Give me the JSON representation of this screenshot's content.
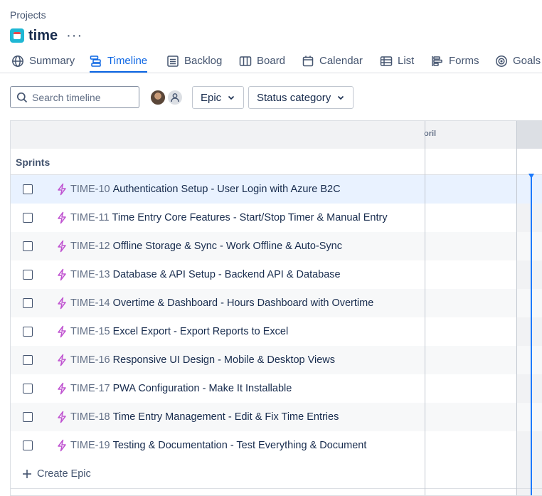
{
  "breadcrumb": "Projects",
  "project": {
    "title": "time",
    "more_icon": "more-horizontal-icon"
  },
  "tabs": [
    {
      "label": "Summary",
      "icon": "globe-icon",
      "active": false
    },
    {
      "label": "Timeline",
      "icon": "timeline-icon",
      "active": true
    },
    {
      "label": "Backlog",
      "icon": "backlog-icon",
      "active": false
    },
    {
      "label": "Board",
      "icon": "board-icon",
      "active": false
    },
    {
      "label": "Calendar",
      "icon": "calendar-icon",
      "active": false
    },
    {
      "label": "List",
      "icon": "list-icon",
      "active": false
    },
    {
      "label": "Forms",
      "icon": "forms-icon",
      "active": false
    },
    {
      "label": "Goals",
      "icon": "goals-icon",
      "active": false
    }
  ],
  "toolbar": {
    "search_placeholder": "Search timeline",
    "epic_filter": "Epic",
    "status_filter": "Status category"
  },
  "timeline": {
    "month_label": "oril",
    "sprints_label": "Sprints",
    "create_label": "Create Epic"
  },
  "epics": [
    {
      "key": "TIME-10",
      "title": "Authentication Setup - User Login with Azure B2C"
    },
    {
      "key": "TIME-11",
      "title": "Time Entry Core Features - Start/Stop Timer & Manual Entry"
    },
    {
      "key": "TIME-12",
      "title": "Offline Storage & Sync - Work Offline & Auto-Sync"
    },
    {
      "key": "TIME-13",
      "title": "Database & API Setup - Backend API & Database"
    },
    {
      "key": "TIME-14",
      "title": "Overtime & Dashboard - Hours Dashboard with Overtime"
    },
    {
      "key": "TIME-15",
      "title": "Excel Export - Export Reports to Excel"
    },
    {
      "key": "TIME-16",
      "title": "Responsive UI Design - Mobile & Desktop Views"
    },
    {
      "key": "TIME-17",
      "title": "PWA Configuration - Make It Installable"
    },
    {
      "key": "TIME-18",
      "title": "Time Entry Management - Edit & Fix Time Entries"
    },
    {
      "key": "TIME-19",
      "title": "Testing & Documentation - Test Everything & Document"
    }
  ],
  "colors": {
    "accent": "#0c66e4",
    "epic_icon": "#c054d1",
    "today_line": "#1d7afc"
  }
}
